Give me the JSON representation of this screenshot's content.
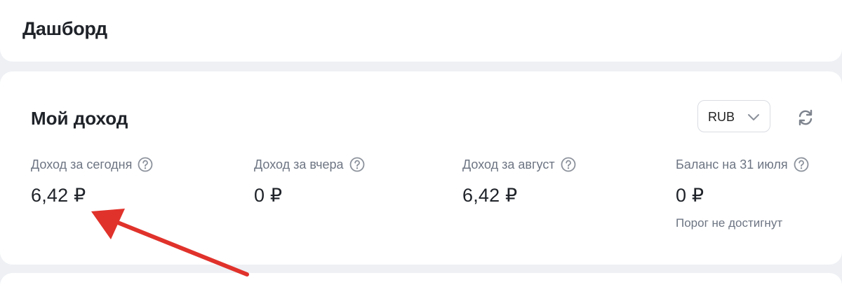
{
  "header": {
    "title": "Дашборд"
  },
  "income": {
    "title": "Мой доход",
    "currency": "RUB",
    "metrics": [
      {
        "label": "Доход за сегодня",
        "value": "6,42 ₽"
      },
      {
        "label": "Доход за вчера",
        "value": "0 ₽"
      },
      {
        "label": "Доход за август",
        "value": "6,42 ₽"
      },
      {
        "label": "Баланс на 31 июля",
        "value": "0 ₽",
        "note": "Порог не достигнут"
      }
    ]
  },
  "annotation": {
    "arrow_color": "#e0322b"
  }
}
